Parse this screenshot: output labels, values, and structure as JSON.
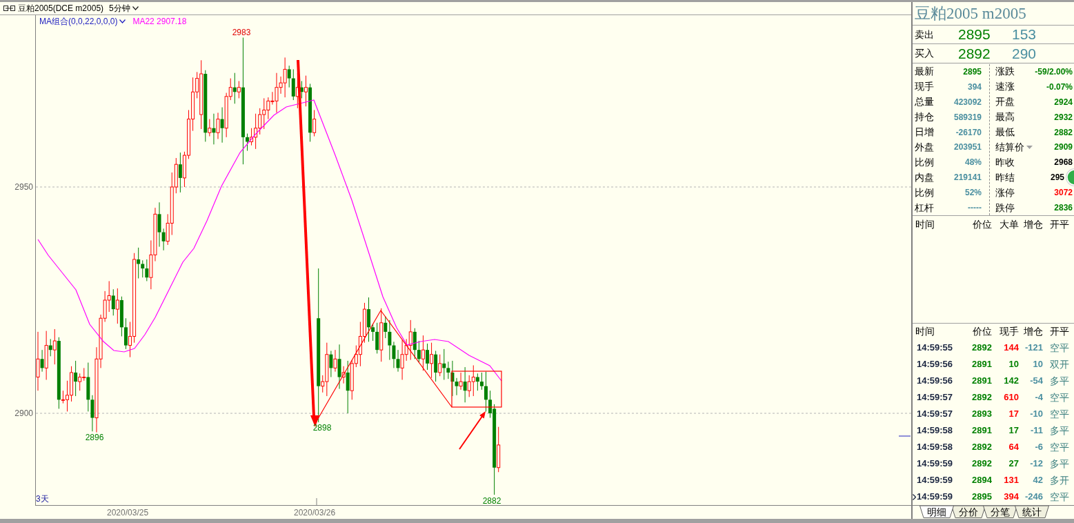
{
  "header": {
    "title": "豆粕2005(DCE m2005)",
    "period": "5分钟"
  },
  "indicator": {
    "name": "MA组合(0,0,22,0,0,0)",
    "value": "MA22 2907.18"
  },
  "chart": {
    "y_labels": [
      "2950",
      "2900"
    ],
    "x_labels": [
      "2020/03/25",
      "2020/03/26"
    ],
    "range_label": "3天",
    "price_labels": [
      {
        "text": "2983",
        "kind": "high"
      },
      {
        "text": "2896",
        "kind": "low"
      },
      {
        "text": "2898",
        "kind": "low"
      },
      {
        "text": "2882",
        "kind": "low"
      }
    ]
  },
  "quote_panel": {
    "title": "豆粕2005 m2005",
    "book": [
      {
        "label": "卖出",
        "price": "2895",
        "volume": "153"
      },
      {
        "label": "买入",
        "price": "2892",
        "volume": "290"
      }
    ],
    "left": [
      {
        "label": "最新",
        "value": "2895",
        "color": "#008000"
      },
      {
        "label": "现手",
        "value": "394",
        "color": "#4a8fa0"
      },
      {
        "label": "总量",
        "value": "423092",
        "color": "#4a8fa0"
      },
      {
        "label": "持仓",
        "value": "589319",
        "color": "#4a8fa0"
      },
      {
        "label": "日增",
        "value": "-26170",
        "color": "#4a8fa0"
      },
      {
        "label": "外盘",
        "value": "203951",
        "color": "#4a8fa0"
      },
      {
        "label": "比例",
        "value": "48%",
        "color": "#4a8fa0"
      },
      {
        "label": "内盘",
        "value": "219141",
        "color": "#4a8fa0"
      },
      {
        "label": "比例",
        "value": "52%",
        "color": "#4a8fa0"
      },
      {
        "label": "杠杆",
        "value": "-----",
        "color": "#4a8fa0"
      }
    ],
    "right": [
      {
        "label": "涨跌",
        "value": "-59/2.00%",
        "color": "#008000",
        "menu": false,
        "covered": false
      },
      {
        "label": "速涨",
        "value": "-0.07%",
        "color": "#008000",
        "menu": false,
        "covered": false
      },
      {
        "label": "开盘",
        "value": "2924",
        "color": "#008000",
        "menu": false,
        "covered": false
      },
      {
        "label": "最高",
        "value": "2932",
        "color": "#008000",
        "menu": false,
        "covered": false
      },
      {
        "label": "最低",
        "value": "2882",
        "color": "#008000",
        "menu": false,
        "covered": false
      },
      {
        "label": "结算价",
        "value": "2909",
        "color": "#008000",
        "menu": true,
        "covered": false
      },
      {
        "label": "昨收",
        "value": "2968",
        "color": "#000000",
        "menu": false,
        "covered": false
      },
      {
        "label": "昨结",
        "value": "295",
        "color": "#000000",
        "menu": false,
        "covered": true
      },
      {
        "label": "涨停",
        "value": "3072",
        "color": "#ff0000",
        "menu": false,
        "covered": false
      },
      {
        "label": "跌停",
        "value": "2836",
        "color": "#008000",
        "menu": false,
        "covered": false
      }
    ]
  },
  "big_orders": {
    "columns": [
      "时间",
      "价位",
      "大单",
      "增仓",
      "开平"
    ]
  },
  "ticks": {
    "columns": [
      "时间",
      "价位",
      "现手",
      "增仓",
      "开平"
    ],
    "rows": [
      {
        "time": "14:59:55",
        "price": "2892",
        "volume": "144",
        "color": "#ff0000",
        "oi": "-121",
        "type": "空平",
        "selected": false
      },
      {
        "time": "14:59:56",
        "price": "2891",
        "volume": "10",
        "color": "#008000",
        "oi": "10",
        "type": "双开",
        "selected": false
      },
      {
        "time": "14:59:56",
        "price": "2891",
        "volume": "142",
        "color": "#008000",
        "oi": "-54",
        "type": "多平",
        "selected": false
      },
      {
        "time": "14:59:57",
        "price": "2892",
        "volume": "610",
        "color": "#ff0000",
        "oi": "-4",
        "type": "空平",
        "selected": false
      },
      {
        "time": "14:59:57",
        "price": "2893",
        "volume": "17",
        "color": "#ff0000",
        "oi": "-10",
        "type": "空平",
        "selected": false
      },
      {
        "time": "14:59:58",
        "price": "2891",
        "volume": "17",
        "color": "#008000",
        "oi": "-11",
        "type": "多平",
        "selected": false
      },
      {
        "time": "14:59:58",
        "price": "2892",
        "volume": "64",
        "color": "#ff0000",
        "oi": "-6",
        "type": "空平",
        "selected": false
      },
      {
        "time": "14:59:59",
        "price": "2892",
        "volume": "27",
        "color": "#008000",
        "oi": "-12",
        "type": "多平",
        "selected": false
      },
      {
        "time": "14:59:59",
        "price": "2894",
        "volume": "131",
        "color": "#ff0000",
        "oi": "42",
        "type": "多开",
        "selected": false
      },
      {
        "time": "14:59:59",
        "price": "2895",
        "volume": "394",
        "color": "#ff0000",
        "oi": "-246",
        "type": "空平",
        "selected": true
      }
    ]
  },
  "tabs": [
    {
      "label": "明细",
      "selected": true
    },
    {
      "label": "分价",
      "selected": false
    },
    {
      "label": "分笔",
      "selected": false
    },
    {
      "label": "统计",
      "selected": false
    }
  ]
}
